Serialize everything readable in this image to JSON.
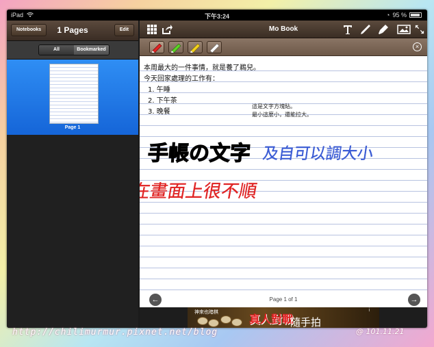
{
  "status_bar": {
    "device": "iPad",
    "time": "下午3:24",
    "battery": "95 %"
  },
  "sidebar": {
    "notebooks_button": "Notebooks",
    "title": "1 Pages",
    "edit_button": "Edit",
    "segments": [
      "All",
      "Bookmarked"
    ],
    "selected_segment": "All",
    "pages": [
      {
        "label": "Page 1"
      }
    ]
  },
  "main": {
    "title": "Mo Book",
    "toolbar_icons": [
      "grid-icon",
      "share-icon",
      "text-tool-icon",
      "pen-tool-icon",
      "marker-tool-icon",
      "image-icon",
      "expand-icon"
    ],
    "pens": [
      {
        "name": "red-pen",
        "color": "#e02424"
      },
      {
        "name": "green-pen",
        "color": "#5bd424"
      },
      {
        "name": "yellow-pen",
        "color": "#f2d21c"
      },
      {
        "name": "eraser",
        "color": "#ffffff"
      }
    ],
    "typed_lines": [
      "本周最大的一件事情，就是養了鵜兒。",
      "今天回家處理的工作有："
    ],
    "list_items": [
      {
        "number": "1.",
        "text": "午睡"
      },
      {
        "number": "2.",
        "text": "下午茶"
      },
      {
        "number": "3.",
        "text": "晚餐"
      }
    ],
    "text_box_lines": [
      "這是文字方塊貼。",
      "最小這麼小，還能拉大。"
    ],
    "handwriting": [
      {
        "text": "手帳の文字",
        "color": "#000000"
      },
      {
        "text": "及自可以調大小",
        "color": "#3a5bd4"
      },
      {
        "text": "在畫面上很不順",
        "color": "#e02424"
      }
    ],
    "page_indicator": "Page 1 of 1"
  },
  "ad": {
    "small_text": "神來也暗棋",
    "big_text": "真人對戰",
    "right_text": "隨手拍",
    "info": "i"
  },
  "watermark": {
    "url": "http://chilimurmur.pixnet.net/blog",
    "date": "@ 101.11.21"
  }
}
